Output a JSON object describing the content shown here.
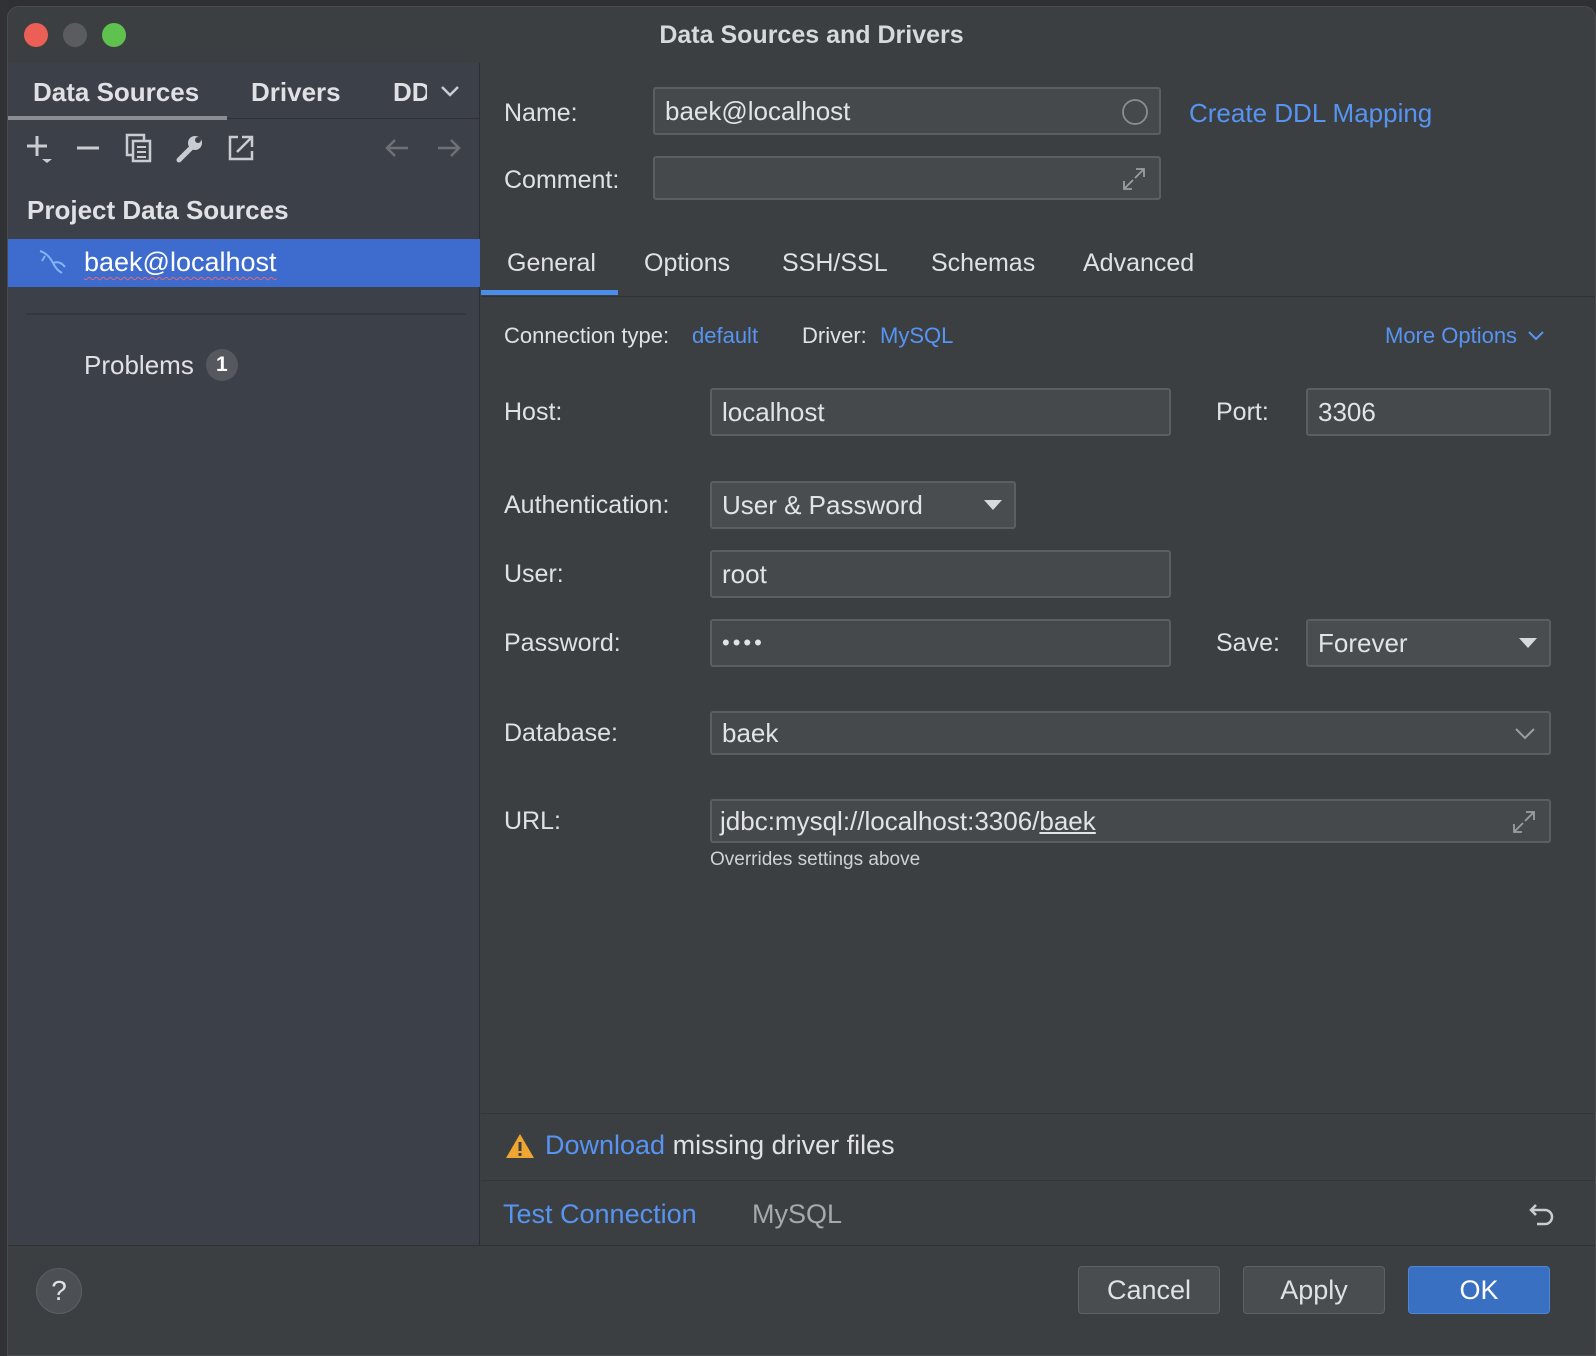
{
  "window": {
    "title": "Data Sources and Drivers"
  },
  "left": {
    "tabs": [
      {
        "label": "Data Sources"
      },
      {
        "label": "Drivers"
      },
      {
        "label": "DD"
      }
    ],
    "section_title": "Project Data Sources",
    "selected_source": "baek@localhost",
    "problems": {
      "label": "Problems",
      "count": "1"
    }
  },
  "form": {
    "name_label": "Name:",
    "name_value": "baek@localhost",
    "create_ddl_link": "Create DDL Mapping",
    "comment_label": "Comment:",
    "comment_value": "",
    "tabs": [
      {
        "label": "General"
      },
      {
        "label": "Options"
      },
      {
        "label": "SSH/SSL"
      },
      {
        "label": "Schemas"
      },
      {
        "label": "Advanced"
      }
    ],
    "connection_type_label": "Connection type:",
    "connection_type_value": "default",
    "driver_label": "Driver:",
    "driver_value": "MySQL",
    "more_options": "More Options",
    "host_label": "Host:",
    "host_value": "localhost",
    "port_label": "Port:",
    "port_value": "3306",
    "auth_label": "Authentication:",
    "auth_value": "User & Password",
    "user_label": "User:",
    "user_value": "root",
    "password_label": "Password:",
    "password_value": "••••",
    "save_label": "Save:",
    "save_value": "Forever",
    "database_label": "Database:",
    "database_value": "baek",
    "url_label": "URL:",
    "url_prefix": "jdbc:mysql://localhost:3306/",
    "url_db": "baek",
    "url_hint": "Overrides settings above"
  },
  "warning": {
    "link": "Download",
    "text": " missing driver files"
  },
  "footer_actions": {
    "test_connection": "Test Connection",
    "driver_name": "MySQL"
  },
  "buttons": {
    "help": "?",
    "cancel": "Cancel",
    "apply": "Apply",
    "ok": "OK"
  },
  "colors": {
    "accent": "#5794f2",
    "selection": "#3d6bce",
    "primary_button": "#3970c2",
    "warning": "#f0a732"
  }
}
